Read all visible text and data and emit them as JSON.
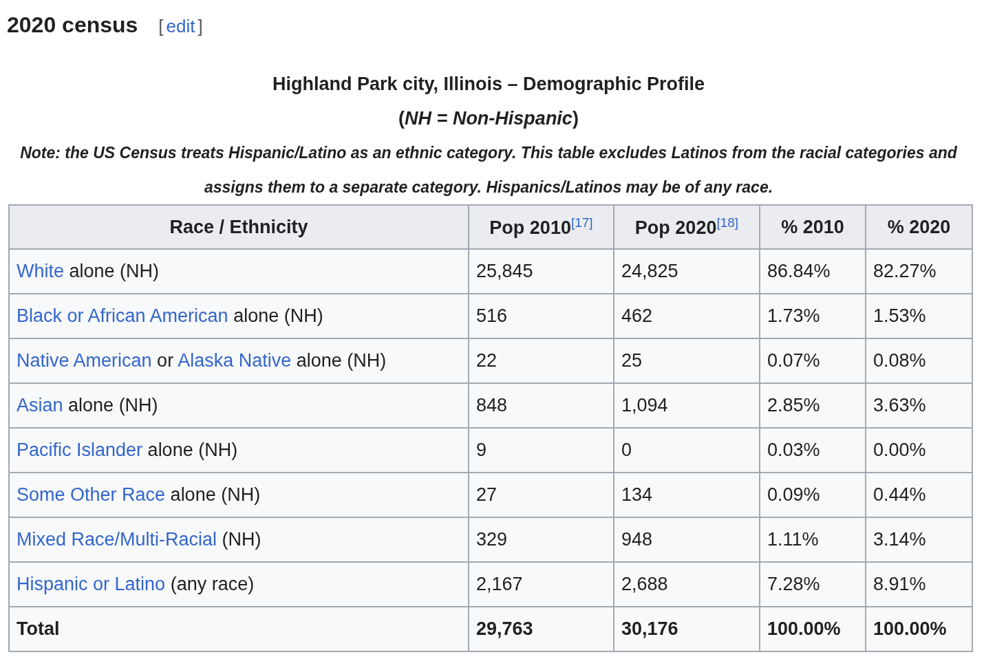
{
  "section": {
    "title": "2020 census",
    "edit_open": "[",
    "edit_link": "edit",
    "edit_close": "]"
  },
  "caption": {
    "title": "Highland Park city, Illinois – Demographic Profile",
    "subtitle": "(*NH = Non-Hispanic*)",
    "note": "Note: the US Census treats Hispanic/Latino as an ethnic category. This table excludes Latinos from the racial categories and assigns them to a separate category. Hispanics/Latinos may be of any race."
  },
  "table": {
    "columns": [
      "Race / Ethnicity",
      "Pop 2010$^{[17]}$",
      "Pop 2020$^{[18]}$",
      "% 2010",
      "% 2020"
    ],
    "rows": [
      {
        "total": false,
        "cells": [
          {
            "parts": [
              {
                "kind": "link",
                "text": "White"
              },
              {
                "kind": "text",
                "text": "alone (NH)"
              }
            ]
          },
          "25,845",
          "24,825",
          "86.84%",
          "82.27%"
        ]
      },
      {
        "total": false,
        "cells": [
          {
            "parts": [
              {
                "kind": "link",
                "text": "Black or African American"
              },
              {
                "kind": "text",
                "text": "alone (NH)"
              }
            ]
          },
          "516",
          "462",
          "1.73%",
          "1.53%"
        ]
      },
      {
        "total": false,
        "cells": [
          {
            "parts": [
              {
                "kind": "link",
                "text": "Native American"
              },
              {
                "kind": "text",
                "text": "or"
              },
              {
                "kind": "link",
                "text": "Alaska Native"
              },
              {
                "kind": "text",
                "text": "alone (NH)"
              }
            ]
          },
          "22",
          "25",
          "0.07%",
          "0.08%"
        ]
      },
      {
        "total": false,
        "cells": [
          {
            "parts": [
              {
                "kind": "link",
                "text": "Asian"
              },
              {
                "kind": "text",
                "text": "alone (NH)"
              }
            ]
          },
          "848",
          "1,094",
          "2.85%",
          "3.63%"
        ]
      },
      {
        "total": false,
        "cells": [
          {
            "parts": [
              {
                "kind": "link",
                "text": "Pacific Islander"
              },
              {
                "kind": "text",
                "text": "alone (NH)"
              }
            ]
          },
          "9",
          "0",
          "0.03%",
          "0.00%"
        ]
      },
      {
        "total": false,
        "cells": [
          {
            "parts": [
              {
                "kind": "link",
                "text": "Some Other Race"
              },
              {
                "kind": "text",
                "text": "alone (NH)"
              }
            ]
          },
          "27",
          "134",
          "0.09%",
          "0.44%"
        ]
      },
      {
        "total": false,
        "cells": [
          {
            "parts": [
              {
                "kind": "link",
                "text": "Mixed Race/Multi-Racial"
              },
              {
                "kind": "text",
                "text": "(NH)"
              }
            ]
          },
          "329",
          "948",
          "1.11%",
          "3.14%"
        ]
      },
      {
        "total": false,
        "cells": [
          {
            "parts": [
              {
                "kind": "link",
                "text": "Hispanic or Latino"
              },
              {
                "kind": "text",
                "text": "(any race)"
              }
            ]
          },
          "2,167",
          "2,688",
          "7.28%",
          "8.91%"
        ]
      },
      {
        "total": true,
        "cells": [
          {
            "parts": [
              {
                "kind": "text",
                "text": "Total"
              }
            ]
          },
          "29,763",
          "30,176",
          "100.00%",
          "100.00%"
        ]
      }
    ]
  }
}
